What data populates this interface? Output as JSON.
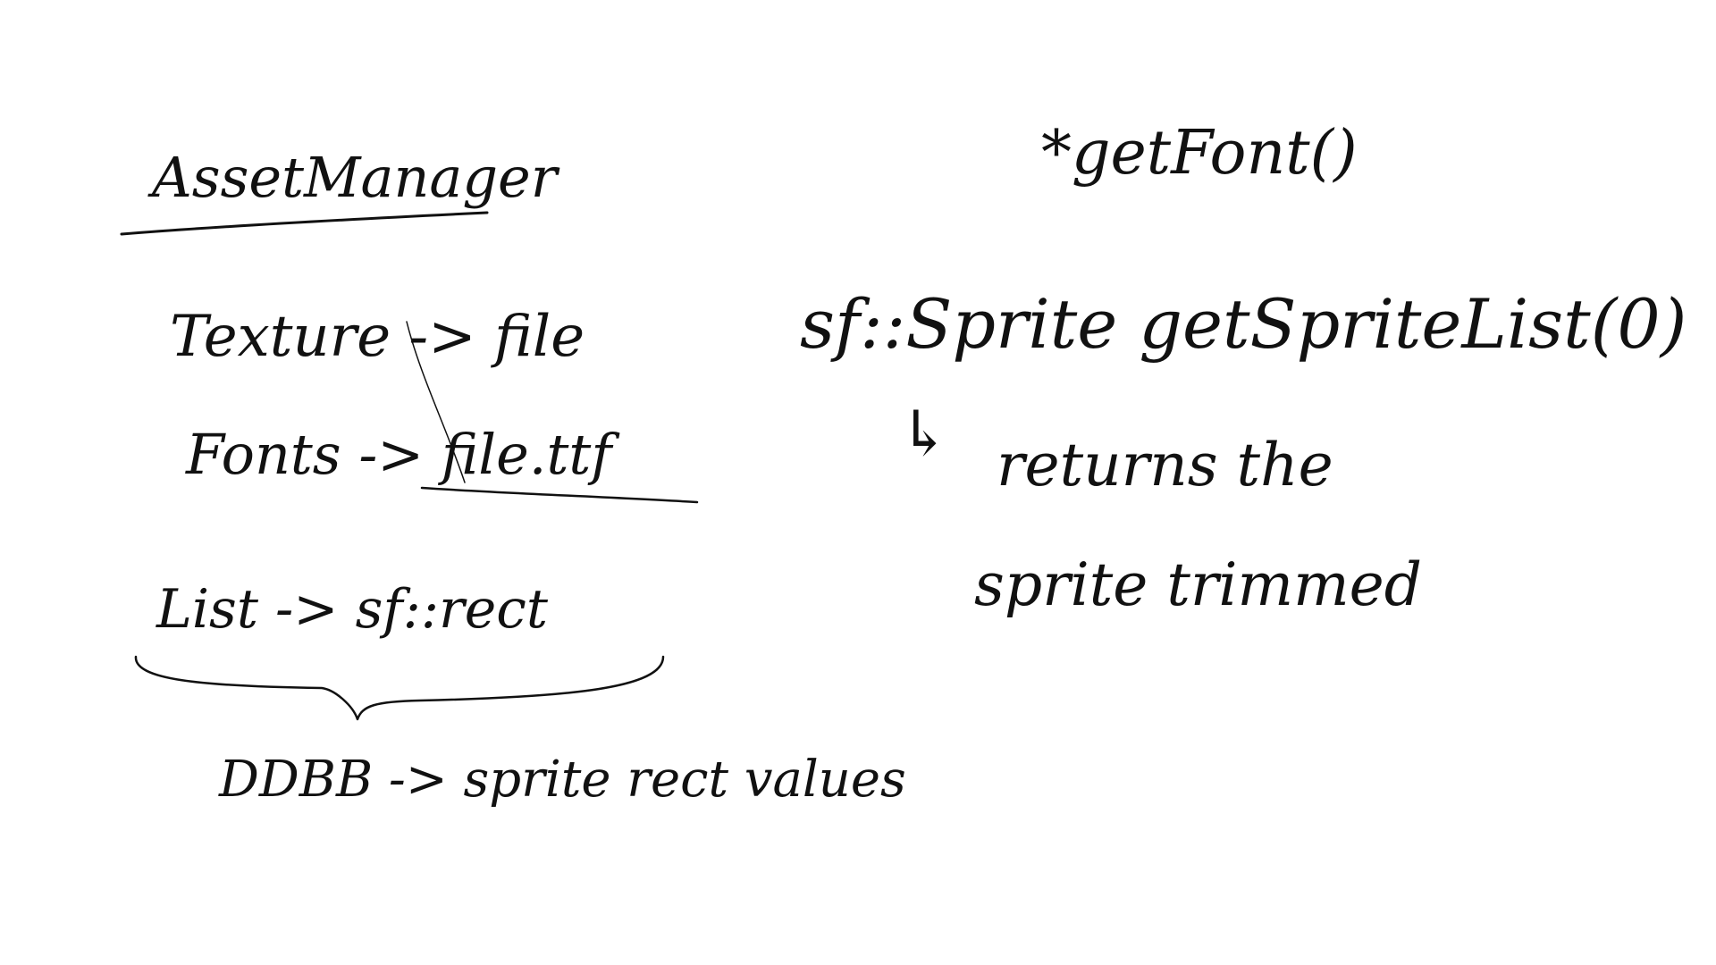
{
  "sketch": {
    "title": "AssetManager",
    "lines": {
      "texture": "Texture -> file",
      "fonts": "Fonts -> file.ttf",
      "list": "List -> sf::rect",
      "ddbb": "DDBB -> sprite rect values",
      "get_font": "*getFont()",
      "get_sprite": "sf::Sprite getSpriteList(0)",
      "returns": "returns the",
      "sprite_trimmed": "sprite trimmed"
    },
    "arrow_glyph": "↳"
  },
  "colors": {
    "ink": "#111111",
    "paper": "#ffffff"
  }
}
